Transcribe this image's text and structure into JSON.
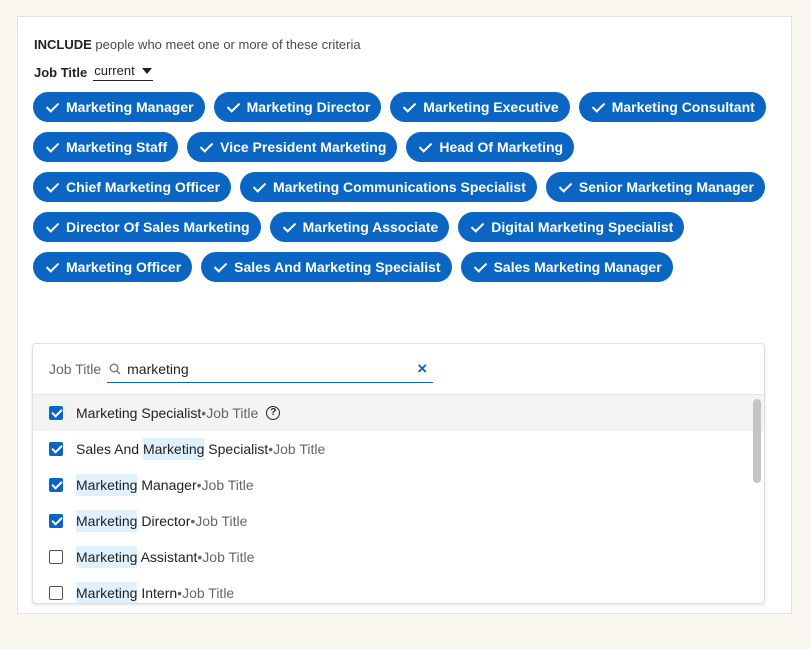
{
  "heading": {
    "include": "INCLUDE",
    "rest": "people who meet one or more of these criteria"
  },
  "filter": {
    "label": "Job Title",
    "scope": "current"
  },
  "chips": [
    "Marketing Manager",
    "Marketing Director",
    "Marketing Executive",
    "Marketing Consultant",
    "Marketing Staff",
    "Vice President Marketing",
    "Head Of Marketing",
    "Chief Marketing Officer",
    "Marketing Communications Specialist",
    "Senior Marketing Manager",
    "Director Of Sales Marketing",
    "Marketing Associate",
    "Digital Marketing Specialist",
    "Marketing Officer",
    "Sales And Marketing Specialist",
    "Sales Marketing Manager"
  ],
  "search": {
    "label": "Job Title",
    "value": "marketing"
  },
  "results": [
    {
      "pre": "",
      "hl": "",
      "post": "Marketing Specialist",
      "type": "Job Title",
      "checked": true,
      "hover": true,
      "help": true
    },
    {
      "pre": "Sales And ",
      "hl": "Marketing",
      "post": " Specialist",
      "type": "Job Title",
      "checked": true
    },
    {
      "pre": "",
      "hl": "Marketing",
      "post": " Manager",
      "type": "Job Title",
      "checked": true
    },
    {
      "pre": "",
      "hl": "Marketing",
      "post": " Director",
      "type": "Job Title",
      "checked": true
    },
    {
      "pre": "",
      "hl": "Marketing",
      "post": " Assistant",
      "type": "Job Title",
      "checked": false
    },
    {
      "pre": "",
      "hl": "Marketing",
      "post": " Intern",
      "type": "Job Title",
      "checked": false
    }
  ],
  "colors": {
    "accent": "#0a66c2",
    "highlight": "#dff1fc",
    "background": "#faf6f0"
  },
  "icons": {
    "chip_check": "check-icon",
    "search": "search-icon",
    "clear": "close-icon",
    "help": "help-icon"
  }
}
